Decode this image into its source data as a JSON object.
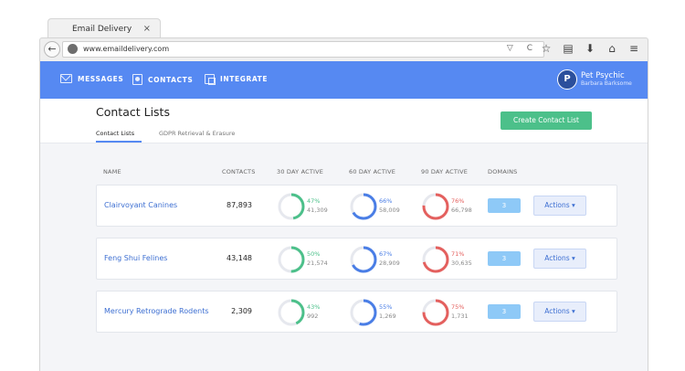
{
  "browser": {
    "tab_title": "Email Delivery",
    "tab_close": "×",
    "back": "←",
    "url": "www.emaildelivery.com",
    "url_buttons": "▽ C",
    "toolbar_icons": [
      "star-icon",
      "reader-icon",
      "download-icon",
      "home-icon",
      "menu-icon"
    ]
  },
  "nav": {
    "messages": "MESSAGES",
    "contacts": "CONTACTS",
    "integrate": "INTEGRATE",
    "account_initial": "P",
    "account_name": "Pet Psychic",
    "account_user": "Barbara Barksome"
  },
  "page": {
    "title": "Contact Lists",
    "tabs": [
      "Contact Lists",
      "GDPR Retrieval & Erasure"
    ],
    "create_button": "Create Contact List"
  },
  "table": {
    "headers": [
      "NAME",
      "CONTACTS",
      "30 DAY ACTIVE",
      "60 DAY ACTIVE",
      "90 DAY ACTIVE",
      "DOMAINS"
    ],
    "actions_label": "Actions ▾",
    "rows": [
      {
        "name": "Clairvoyant Canines",
        "contacts": "87,893",
        "d30": {
          "pct": "47%",
          "count": "41,309",
          "fraction": 0.47
        },
        "d60": {
          "pct": "66%",
          "count": "58,009",
          "fraction": 0.66
        },
        "d90": {
          "pct": "76%",
          "count": "66,798",
          "fraction": 0.76
        },
        "domains": "3"
      },
      {
        "name": "Feng Shui Felines",
        "contacts": "43,148",
        "d30": {
          "pct": "50%",
          "count": "21,574",
          "fraction": 0.5
        },
        "d60": {
          "pct": "67%",
          "count": "28,909",
          "fraction": 0.67
        },
        "d90": {
          "pct": "71%",
          "count": "30,635",
          "fraction": 0.71
        },
        "domains": "3"
      },
      {
        "name": "Mercury Retrograde Rodents",
        "contacts": "2,309",
        "d30": {
          "pct": "43%",
          "count": "992",
          "fraction": 0.43
        },
        "d60": {
          "pct": "55%",
          "count": "1,269",
          "fraction": 0.55
        },
        "d90": {
          "pct": "75%",
          "count": "1,731",
          "fraction": 0.75
        },
        "domains": "3"
      }
    ]
  },
  "colors": {
    "nav_blue": "#5689f2",
    "green": "#4cc08a",
    "blue": "#4a7ee6",
    "red": "#e4605e",
    "track": "#e6e8ee",
    "link_blue": "#3d6fd2"
  }
}
